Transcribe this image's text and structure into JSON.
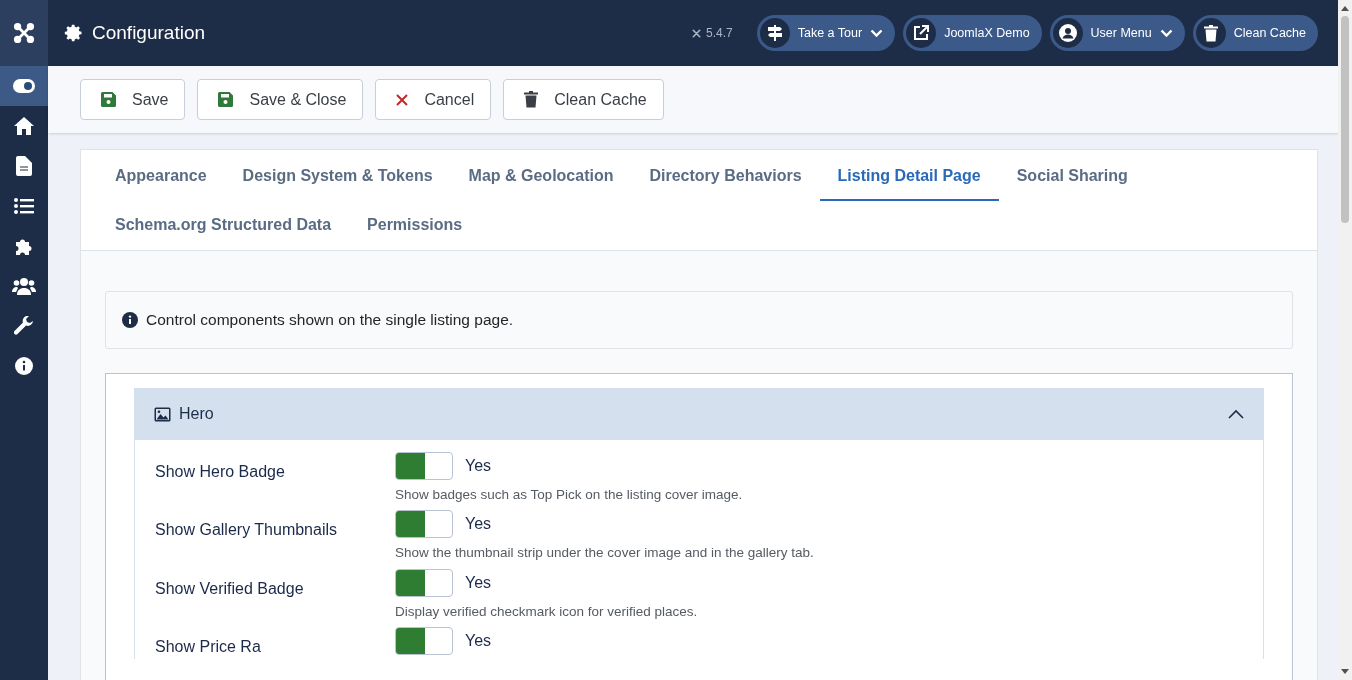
{
  "header": {
    "title": "Configuration",
    "version": "5.4.7",
    "buttons": [
      {
        "kind": "tour",
        "label": "Take a Tour",
        "dropdown": true
      },
      {
        "kind": "external",
        "label": "JoomlaX Demo",
        "dropdown": false
      },
      {
        "kind": "user",
        "label": "User Menu",
        "dropdown": true
      },
      {
        "kind": "trash",
        "label": "Clean Cache",
        "dropdown": false
      }
    ]
  },
  "sidebar": {
    "items": [
      {
        "kind": "toggle",
        "selected": true
      },
      {
        "kind": "home",
        "selected": false
      },
      {
        "kind": "file",
        "selected": false
      },
      {
        "kind": "list",
        "selected": false
      },
      {
        "kind": "puzzle",
        "selected": false
      },
      {
        "kind": "users",
        "selected": false
      },
      {
        "kind": "wrench",
        "selected": false
      },
      {
        "kind": "info",
        "selected": false
      }
    ]
  },
  "toolbar": [
    {
      "kind": "save",
      "label": "Save"
    },
    {
      "kind": "save",
      "label": "Save & Close"
    },
    {
      "kind": "cancel",
      "label": "Cancel"
    },
    {
      "kind": "trash",
      "label": "Clean Cache"
    }
  ],
  "tabs": [
    {
      "label": "Appearance",
      "selected": false
    },
    {
      "label": "Design System & Tokens",
      "selected": false
    },
    {
      "label": "Map & Geolocation",
      "selected": false
    },
    {
      "label": "Directory Behaviors",
      "selected": false
    },
    {
      "label": "Listing Detail Page",
      "selected": true
    },
    {
      "label": "Social Sharing",
      "selected": false
    },
    {
      "label": "Schema.org Structured Data",
      "selected": false
    },
    {
      "label": "Permissions",
      "selected": false
    }
  ],
  "info": "Control components shown on the single listing page.",
  "section": {
    "title": "Hero",
    "expanded": true,
    "fields": [
      {
        "label": "Show Hero Badge",
        "on": true,
        "value": "Yes",
        "description": "Show badges such as Top Pick on the listing cover image."
      },
      {
        "label": "Show Gallery Thumbnails",
        "on": true,
        "value": "Yes",
        "description": "Show the thumbnail strip under the cover image and in the gallery tab."
      },
      {
        "label": "Show Verified Badge",
        "on": true,
        "value": "Yes",
        "description": "Display verified checkmark icon for verified places."
      },
      {
        "label": "Show Price Ra",
        "on": true,
        "value": "Yes"
      }
    ]
  }
}
